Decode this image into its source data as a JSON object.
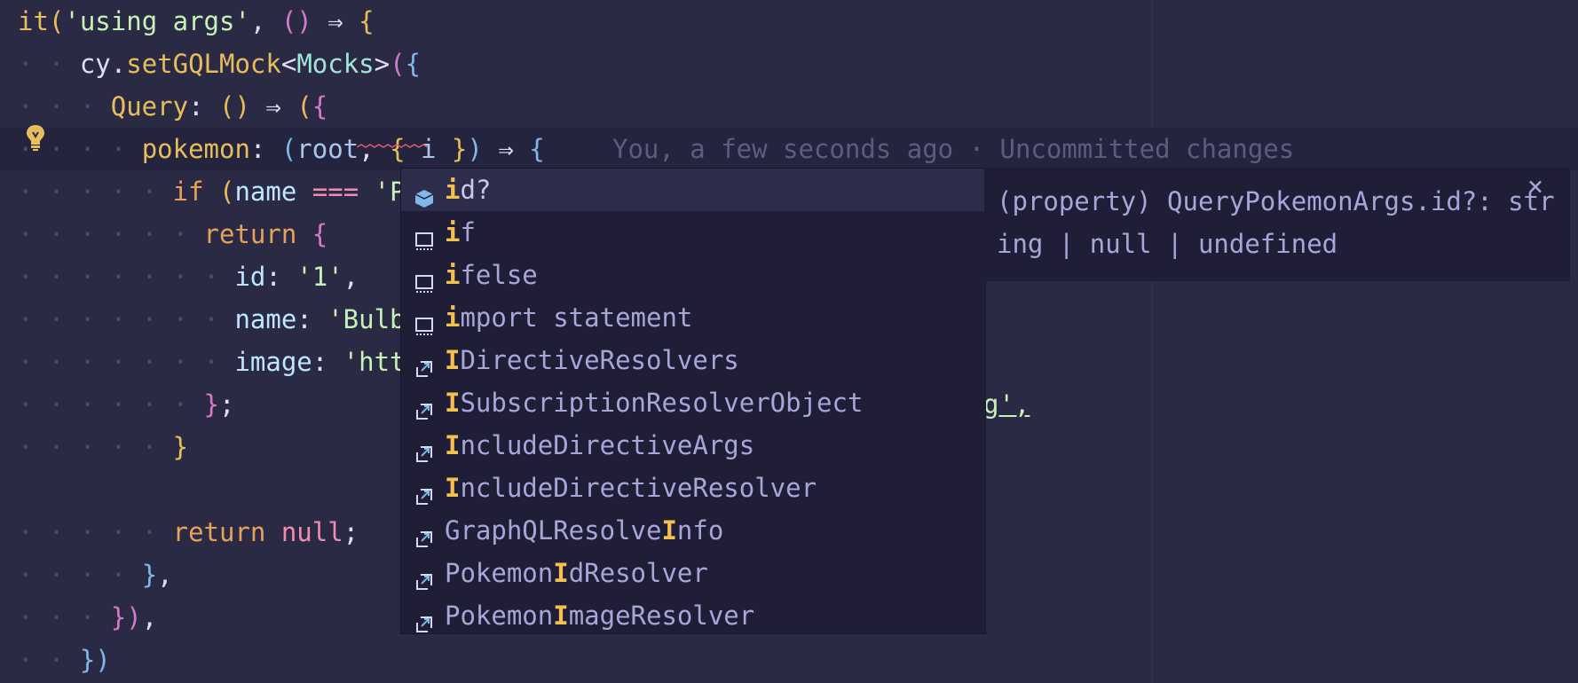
{
  "editor": {
    "blame": "You, a few seconds ago · Uncommitted changes",
    "lines": [
      {
        "dots": "",
        "segments": [
          [
            "c-kw",
            "it"
          ],
          [
            "c-br1",
            "("
          ],
          [
            "c-str",
            "'using args'"
          ],
          [
            "c-pun",
            ", "
          ],
          [
            "c-br2",
            "()"
          ],
          [
            "c-op",
            " ⇒ "
          ],
          [
            "c-br1",
            "{"
          ]
        ]
      },
      {
        "dots": "· · ",
        "segments": [
          [
            "c-pun",
            "cy."
          ],
          [
            "c-fn",
            "setGQLMock"
          ],
          [
            "c-pun",
            "<"
          ],
          [
            "c-type",
            "Mocks"
          ],
          [
            "c-pun",
            ">"
          ],
          [
            "c-br2",
            "("
          ],
          [
            "c-br3",
            "{"
          ]
        ]
      },
      {
        "dots": "· · · ",
        "segments": [
          [
            "c-kw",
            "Query"
          ],
          [
            "c-pun",
            ": "
          ],
          [
            "c-br1",
            "()"
          ],
          [
            "c-op",
            " ⇒ "
          ],
          [
            "c-br1",
            "("
          ],
          [
            "c-br2",
            "{"
          ]
        ]
      },
      {
        "dots": "· · · · ",
        "segments": [
          [
            "c-kw",
            "pokemon"
          ],
          [
            "c-pun",
            ": "
          ],
          [
            "c-br3",
            "("
          ],
          [
            "c-param",
            "root"
          ],
          [
            "c-pun",
            ", "
          ],
          [
            "c-br1",
            "{"
          ],
          [
            "c-param",
            " i "
          ],
          [
            "c-br1",
            "}"
          ],
          [
            "c-br3",
            ")"
          ],
          [
            "c-op",
            " ⇒ "
          ],
          [
            "c-br3",
            "{"
          ]
        ]
      },
      {
        "dots": "· · · · · ",
        "segments": [
          [
            "c-ret",
            "if "
          ],
          [
            "c-br1",
            "("
          ],
          [
            "c-prop",
            "name"
          ],
          [
            "c-null",
            " === "
          ],
          [
            "c-str",
            "'Pik"
          ]
        ]
      },
      {
        "dots": "· · · · · · ",
        "segments": [
          [
            "c-ret",
            "return "
          ],
          [
            "c-br2",
            "{"
          ]
        ]
      },
      {
        "dots": "· · · · · · · ",
        "segments": [
          [
            "c-prop",
            "id"
          ],
          [
            "c-pun",
            ": "
          ],
          [
            "c-str",
            "'1'"
          ],
          [
            "c-pun",
            ","
          ]
        ]
      },
      {
        "dots": "· · · · · · · ",
        "segments": [
          [
            "c-prop",
            "name"
          ],
          [
            "c-pun",
            ": "
          ],
          [
            "c-str",
            "'Bulbas"
          ]
        ]
      },
      {
        "dots": "· · · · · · · ",
        "segments": [
          [
            "c-prop",
            "image"
          ],
          [
            "c-pun",
            ": "
          ],
          [
            "c-str",
            "'https"
          ]
        ]
      },
      {
        "dots": "· · · · · · ",
        "segments": [
          [
            "c-br2",
            "}"
          ],
          [
            "c-pun",
            ";"
          ]
        ]
      },
      {
        "dots": "· · · · · ",
        "segments": [
          [
            "c-br1",
            "}"
          ]
        ]
      },
      {
        "dots": "",
        "segments": []
      },
      {
        "dots": "· · · · · ",
        "segments": [
          [
            "c-ret",
            "return "
          ],
          [
            "c-null",
            "null"
          ],
          [
            "c-pun",
            ";"
          ]
        ]
      },
      {
        "dots": "· · · · ",
        "segments": [
          [
            "c-br3",
            "}"
          ],
          [
            "c-pun",
            ","
          ]
        ]
      },
      {
        "dots": "· · · ",
        "segments": [
          [
            "c-br2",
            "})"
          ],
          [
            "c-pun",
            ","
          ]
        ]
      },
      {
        "dots": "· · ",
        "segments": [
          [
            "c-br3",
            "})"
          ]
        ]
      }
    ],
    "image_tail": "g',"
  },
  "suggest": {
    "items": [
      {
        "icon": "property-icon",
        "pre": "",
        "hl": "i",
        "post": "d?"
      },
      {
        "icon": "snippet-icon",
        "pre": "",
        "hl": "i",
        "post": "f"
      },
      {
        "icon": "snippet-icon",
        "pre": "",
        "hl": "i",
        "post": "felse"
      },
      {
        "icon": "snippet-icon",
        "pre": "",
        "hl": "i",
        "post": "mport statement"
      },
      {
        "icon": "reference-icon",
        "pre": "",
        "hl": "I",
        "post": "DirectiveResolvers"
      },
      {
        "icon": "reference-icon",
        "pre": "",
        "hl": "I",
        "post": "SubscriptionResolverObject"
      },
      {
        "icon": "reference-icon",
        "pre": "",
        "hl": "I",
        "post": "ncludeDirectiveArgs"
      },
      {
        "icon": "reference-icon",
        "pre": "",
        "hl": "I",
        "post": "ncludeDirectiveResolver"
      },
      {
        "icon": "reference-icon",
        "pre": "GraphQLResolve",
        "hl": "I",
        "post": "nfo"
      },
      {
        "icon": "reference-icon",
        "pre": "Pokemon",
        "hl": "I",
        "post": "dResolver"
      },
      {
        "icon": "reference-icon",
        "pre": "Pokemon",
        "hl": "I",
        "post": "mageResolver"
      }
    ],
    "details_line1": "(property) QueryPokemonArgs.id?: str",
    "details_line2": "ing | null | undefined",
    "close_label": "×"
  }
}
